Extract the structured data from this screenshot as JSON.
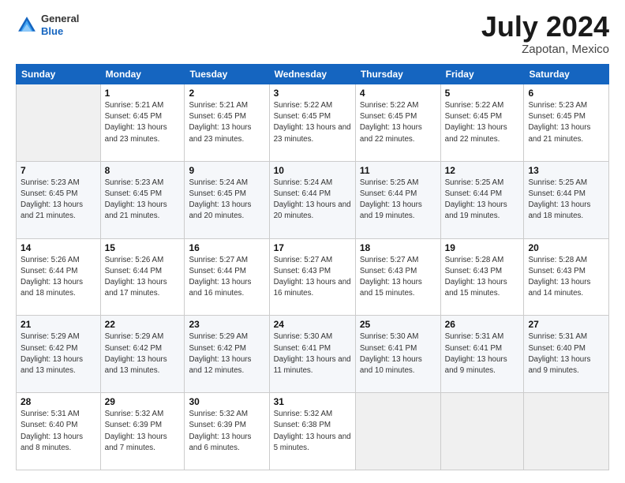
{
  "header": {
    "logo_line1": "General",
    "logo_line2": "Blue",
    "title": "July 2024",
    "subtitle": "Zapotan, Mexico"
  },
  "calendar": {
    "columns": [
      "Sunday",
      "Monday",
      "Tuesday",
      "Wednesday",
      "Thursday",
      "Friday",
      "Saturday"
    ],
    "weeks": [
      [
        {
          "day": "",
          "empty": true
        },
        {
          "day": "1",
          "sunrise": "5:21 AM",
          "sunset": "6:45 PM",
          "daylight": "13 hours and 23 minutes."
        },
        {
          "day": "2",
          "sunrise": "5:21 AM",
          "sunset": "6:45 PM",
          "daylight": "13 hours and 23 minutes."
        },
        {
          "day": "3",
          "sunrise": "5:22 AM",
          "sunset": "6:45 PM",
          "daylight": "13 hours and 23 minutes."
        },
        {
          "day": "4",
          "sunrise": "5:22 AM",
          "sunset": "6:45 PM",
          "daylight": "13 hours and 22 minutes."
        },
        {
          "day": "5",
          "sunrise": "5:22 AM",
          "sunset": "6:45 PM",
          "daylight": "13 hours and 22 minutes."
        },
        {
          "day": "6",
          "sunrise": "5:23 AM",
          "sunset": "6:45 PM",
          "daylight": "13 hours and 21 minutes."
        }
      ],
      [
        {
          "day": "7",
          "sunrise": "5:23 AM",
          "sunset": "6:45 PM",
          "daylight": "13 hours and 21 minutes."
        },
        {
          "day": "8",
          "sunrise": "5:23 AM",
          "sunset": "6:45 PM",
          "daylight": "13 hours and 21 minutes."
        },
        {
          "day": "9",
          "sunrise": "5:24 AM",
          "sunset": "6:45 PM",
          "daylight": "13 hours and 20 minutes."
        },
        {
          "day": "10",
          "sunrise": "5:24 AM",
          "sunset": "6:44 PM",
          "daylight": "13 hours and 20 minutes."
        },
        {
          "day": "11",
          "sunrise": "5:25 AM",
          "sunset": "6:44 PM",
          "daylight": "13 hours and 19 minutes."
        },
        {
          "day": "12",
          "sunrise": "5:25 AM",
          "sunset": "6:44 PM",
          "daylight": "13 hours and 19 minutes."
        },
        {
          "day": "13",
          "sunrise": "5:25 AM",
          "sunset": "6:44 PM",
          "daylight": "13 hours and 18 minutes."
        }
      ],
      [
        {
          "day": "14",
          "sunrise": "5:26 AM",
          "sunset": "6:44 PM",
          "daylight": "13 hours and 18 minutes."
        },
        {
          "day": "15",
          "sunrise": "5:26 AM",
          "sunset": "6:44 PM",
          "daylight": "13 hours and 17 minutes."
        },
        {
          "day": "16",
          "sunrise": "5:27 AM",
          "sunset": "6:44 PM",
          "daylight": "13 hours and 16 minutes."
        },
        {
          "day": "17",
          "sunrise": "5:27 AM",
          "sunset": "6:43 PM",
          "daylight": "13 hours and 16 minutes."
        },
        {
          "day": "18",
          "sunrise": "5:27 AM",
          "sunset": "6:43 PM",
          "daylight": "13 hours and 15 minutes."
        },
        {
          "day": "19",
          "sunrise": "5:28 AM",
          "sunset": "6:43 PM",
          "daylight": "13 hours and 15 minutes."
        },
        {
          "day": "20",
          "sunrise": "5:28 AM",
          "sunset": "6:43 PM",
          "daylight": "13 hours and 14 minutes."
        }
      ],
      [
        {
          "day": "21",
          "sunrise": "5:29 AM",
          "sunset": "6:42 PM",
          "daylight": "13 hours and 13 minutes."
        },
        {
          "day": "22",
          "sunrise": "5:29 AM",
          "sunset": "6:42 PM",
          "daylight": "13 hours and 13 minutes."
        },
        {
          "day": "23",
          "sunrise": "5:29 AM",
          "sunset": "6:42 PM",
          "daylight": "13 hours and 12 minutes."
        },
        {
          "day": "24",
          "sunrise": "5:30 AM",
          "sunset": "6:41 PM",
          "daylight": "13 hours and 11 minutes."
        },
        {
          "day": "25",
          "sunrise": "5:30 AM",
          "sunset": "6:41 PM",
          "daylight": "13 hours and 10 minutes."
        },
        {
          "day": "26",
          "sunrise": "5:31 AM",
          "sunset": "6:41 PM",
          "daylight": "13 hours and 9 minutes."
        },
        {
          "day": "27",
          "sunrise": "5:31 AM",
          "sunset": "6:40 PM",
          "daylight": "13 hours and 9 minutes."
        }
      ],
      [
        {
          "day": "28",
          "sunrise": "5:31 AM",
          "sunset": "6:40 PM",
          "daylight": "13 hours and 8 minutes."
        },
        {
          "day": "29",
          "sunrise": "5:32 AM",
          "sunset": "6:39 PM",
          "daylight": "13 hours and 7 minutes."
        },
        {
          "day": "30",
          "sunrise": "5:32 AM",
          "sunset": "6:39 PM",
          "daylight": "13 hours and 6 minutes."
        },
        {
          "day": "31",
          "sunrise": "5:32 AM",
          "sunset": "6:38 PM",
          "daylight": "13 hours and 5 minutes."
        },
        {
          "day": "",
          "empty": true
        },
        {
          "day": "",
          "empty": true
        },
        {
          "day": "",
          "empty": true
        }
      ]
    ]
  },
  "labels": {
    "sunrise_prefix": "Sunrise: ",
    "sunset_prefix": "Sunset: ",
    "daylight_prefix": "Daylight: "
  }
}
